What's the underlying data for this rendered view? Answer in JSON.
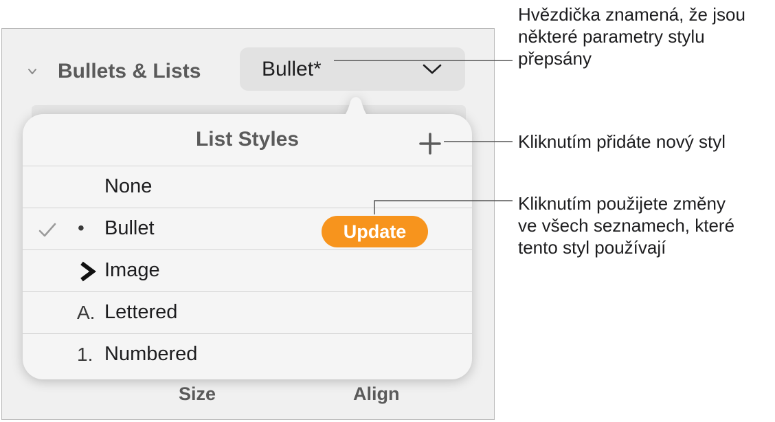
{
  "section": {
    "title": "Bullets & Lists",
    "dropdown_value": "Bullet*"
  },
  "popover": {
    "title": "List Styles",
    "rows": [
      {
        "label": "None",
        "marker": "",
        "checked": false
      },
      {
        "label": "Bullet",
        "marker": "•",
        "checked": true,
        "action_label": "Update"
      },
      {
        "label": "Image",
        "marker": "image-chevron",
        "checked": false
      },
      {
        "label": "Lettered",
        "marker": "A.",
        "checked": false
      },
      {
        "label": "Numbered",
        "marker": "1.",
        "checked": false
      }
    ]
  },
  "bottom_labels": {
    "size": "Size",
    "align": "Align"
  },
  "callouts": {
    "asterisk": [
      "Hvězdička znamená, že jsou",
      "některé parametry stylu",
      "přepsány"
    ],
    "add_style": [
      "Kliknutím přidáte nový styl"
    ],
    "update": [
      "Kliknutím použijete změny",
      "ve všech seznamech, které",
      "tento styl používají"
    ]
  },
  "colors": {
    "accent_orange": "#f7941d",
    "panel_bg": "#f0f0f0",
    "popover_bg": "#f5f5f5"
  }
}
